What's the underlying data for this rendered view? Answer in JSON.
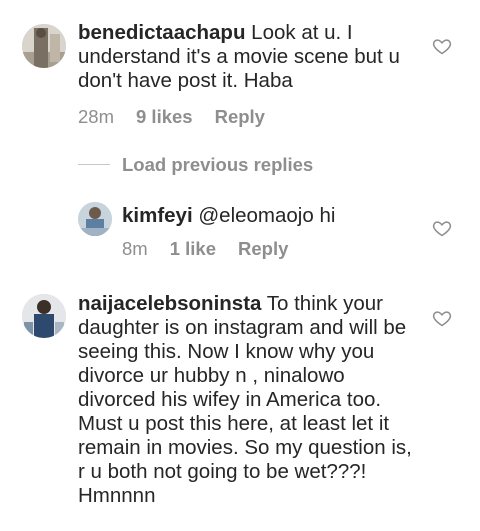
{
  "comments": [
    {
      "username": "benedictaachapu",
      "text": " Look at u. I understand it's a movie scene but u don't have post it. Haba",
      "time": "28m",
      "likes": "9 likes",
      "reply": "Reply"
    },
    {
      "username": "kimfeyi",
      "mention": "@eleomaojo",
      "text": " hi",
      "time": "8m",
      "likes": "1 like",
      "reply": "Reply"
    },
    {
      "username": "naijacelebsoninsta",
      "text": " To think your daughter is on instagram and will be seeing this. Now I know why you divorce ur hubby n , ninalowo divorced his wifey in America too. Must u post this here, at least let it remain in movies. So my question is, r u both not going to be wet???! Hmnnnn"
    }
  ],
  "load_previous": "Load previous replies",
  "icons": {
    "heart": "heart-outline-icon",
    "avatar": "profile-avatar"
  },
  "colors": {
    "text": "#262626",
    "meta": "#8e8e8e",
    "divider": "#c7c7c7"
  }
}
